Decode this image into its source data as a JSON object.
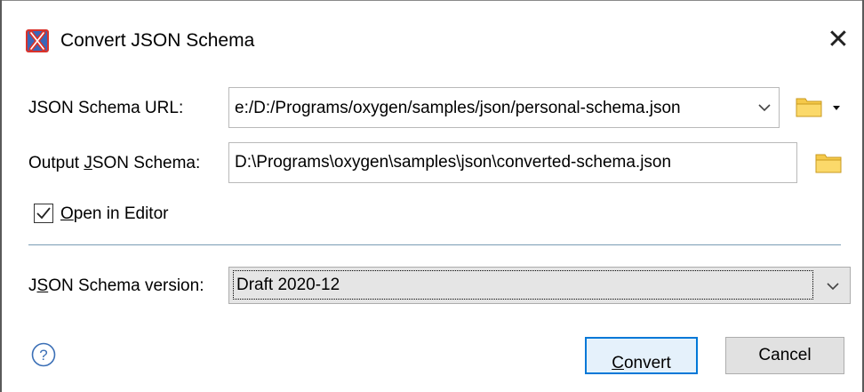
{
  "dialog": {
    "title": "Convert JSON Schema",
    "close_glyph": "✕"
  },
  "url_field": {
    "label_pre": "",
    "label_mnemonic": "",
    "label_post": "JSON Schema URL:",
    "value": "e:/D:/Programs/oxygen/samples/json/personal-schema.json"
  },
  "output_field": {
    "label_pre": "Output ",
    "label_mnemonic": "J",
    "label_post": "SON Schema:",
    "value": "D:\\Programs\\oxygen\\samples\\json\\converted-schema.json"
  },
  "open_in_editor": {
    "checked": true,
    "label_mnemonic": "O",
    "label_rest": "pen in Editor"
  },
  "version": {
    "label_pre": "J",
    "label_mnemonic": "S",
    "label_post": "ON Schema version:",
    "selected": "Draft 2020-12"
  },
  "buttons": {
    "convert_mnemonic": "C",
    "convert_rest": "onvert",
    "cancel": "Cancel"
  },
  "icons": {
    "app": "oxygen-app-icon",
    "close": "close-icon",
    "folder": "folder-icon",
    "chevron": "chevron-down-icon",
    "help": "help-icon",
    "checkmark": "checkmark-icon"
  },
  "colors": {
    "accent": "#0078d7",
    "folder": "#f5c94a",
    "separator": "#7a9cb4"
  }
}
